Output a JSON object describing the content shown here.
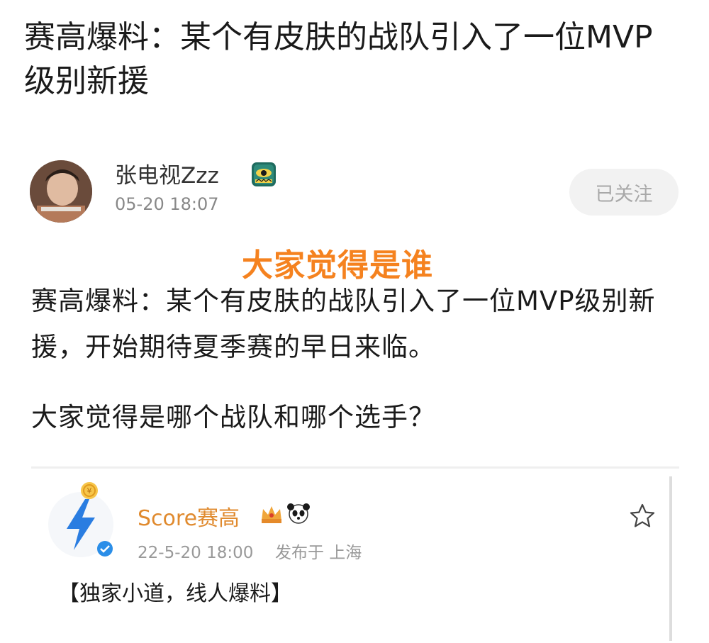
{
  "post": {
    "title": "赛高爆料：某个有皮肤的战队引入了一位MVP级别新援",
    "author": {
      "name": "张电视Zzz",
      "time": "05-20 18:07",
      "badge_icon": "eye-crown-badge-icon"
    },
    "follow_label": "已关注",
    "overlay_caption": "大家觉得是谁",
    "paragraphs": [
      "赛高爆料：某个有皮肤的战队引入了一位MVP级别新援，开始期待夏季赛的早日来临。",
      "大家觉得是哪个战队和哪个选手？"
    ]
  },
  "embed": {
    "name": "Score赛高",
    "time": "22-5-20 18:00",
    "location": "发布于 上海",
    "text": "【独家小道，线人爆料】",
    "avatar_icon": "lightning-bolt-icon",
    "colors": {
      "name": "#e08a2e",
      "accent": "#f5821f",
      "bolt": "#2a7de1"
    }
  }
}
